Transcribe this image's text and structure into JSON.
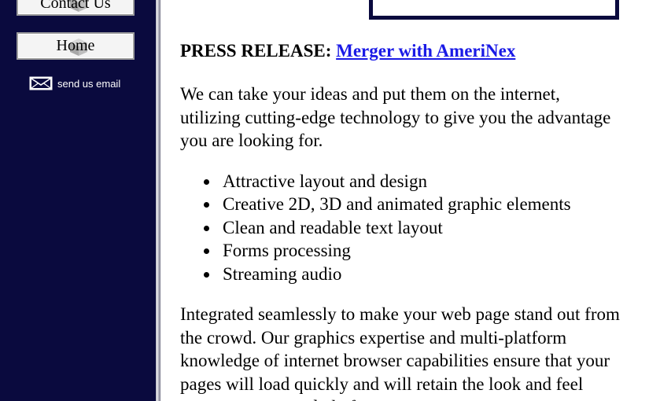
{
  "sidebar": {
    "nav": {
      "contact_label": "Contact Us",
      "home_label": "Home"
    },
    "email_label": "send us email",
    "background_color": "#0a0a3e"
  },
  "main": {
    "press": {
      "prefix": "PRESS RELEASE:",
      "link_text": "Merger with AmeriNex"
    },
    "intro": "We can take your ideas and put them on the internet, utilizing cutting-edge technology to give you the advantage you are looking for.",
    "features": [
      "Attractive layout and design",
      "Creative 2D, 3D and animated graphic elements",
      "Clean and readable text layout",
      "Forms processing",
      "Streaming audio"
    ],
    "closing": "Integrated seamlessly to make your web page stand out from the crowd. Our graphics expertise and multi-platform knowledge of internet browser capabilities ensure that your pages will load quickly and will retain the look and feel across systems and platforms."
  },
  "colors": {
    "link": "#1a1ae6",
    "sidebar": "#0a0a3e"
  }
}
